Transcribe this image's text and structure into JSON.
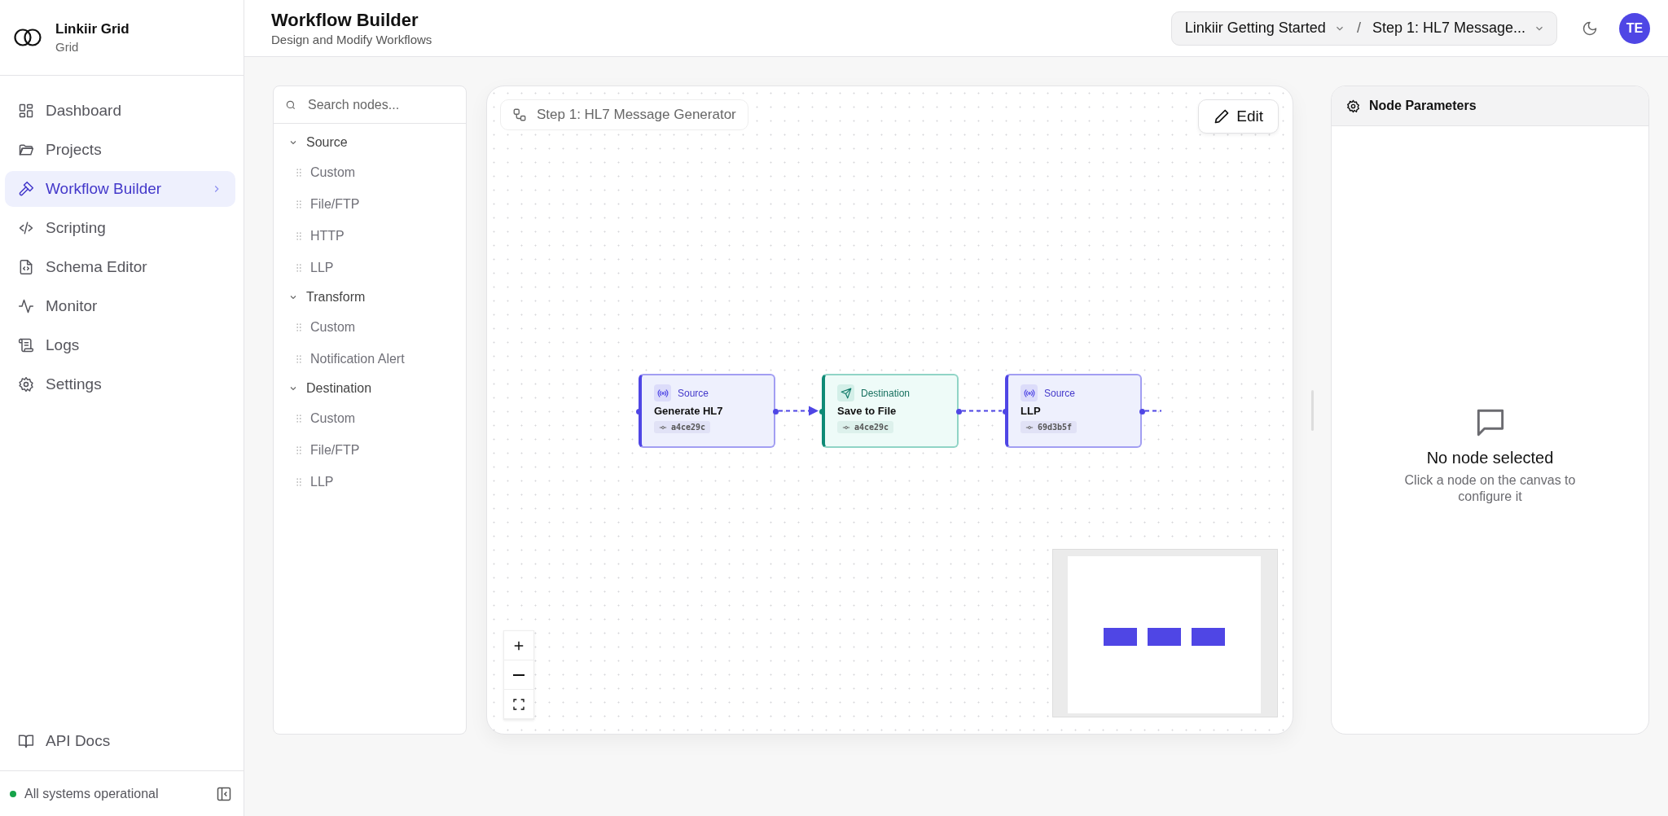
{
  "brand": {
    "name": "Linkiir Grid",
    "subtitle": "Grid"
  },
  "sidebar": {
    "items": [
      {
        "label": "Dashboard",
        "selected": false
      },
      {
        "label": "Projects",
        "selected": false
      },
      {
        "label": "Workflow Builder",
        "selected": true
      },
      {
        "label": "Scripting",
        "selected": false
      },
      {
        "label": "Schema Editor",
        "selected": false
      },
      {
        "label": "Monitor",
        "selected": false
      },
      {
        "label": "Logs",
        "selected": false
      },
      {
        "label": "Settings",
        "selected": false
      }
    ],
    "footer_link": "API Docs",
    "status": "All systems operational"
  },
  "header": {
    "title": "Workflow Builder",
    "subtitle": "Design and Modify Workflows",
    "breadcrumbs": [
      {
        "label": "Linkiir Getting Started"
      },
      {
        "label": "Step 1: HL7 Message..."
      }
    ],
    "separator": "/",
    "avatar": "TE"
  },
  "palette": {
    "search": {
      "placeholder": "Search nodes..."
    },
    "groups": [
      {
        "label": "Source",
        "expanded": true,
        "items": [
          "Custom",
          "File/FTP",
          "HTTP",
          "LLP"
        ]
      },
      {
        "label": "Transform",
        "expanded": true,
        "items": [
          "Custom",
          "Notification Alert"
        ]
      },
      {
        "label": "Destination",
        "expanded": true,
        "items": [
          "Custom",
          "File/FTP",
          "LLP"
        ]
      }
    ]
  },
  "canvas": {
    "workflow_label": "Step 1: HL7 Message Generator",
    "edit_button": "Edit",
    "nodes": [
      {
        "kind": "source",
        "type_label": "Source",
        "title": "Generate HL7",
        "id_label": "a4ce29c"
      },
      {
        "kind": "destination",
        "type_label": "Destination",
        "title": "Save to File",
        "id_label": "a4ce29c"
      },
      {
        "kind": "source",
        "type_label": "Source",
        "title": "LLP",
        "id_label": "69d3b5f"
      }
    ],
    "edges": [
      {
        "kind": "arrow"
      },
      {
        "kind": "line"
      },
      {
        "kind": "open"
      }
    ]
  },
  "parameters": {
    "title": "Node Parameters",
    "empty_title": "No node selected",
    "empty_text": "Click a node on the canvas to configure it"
  }
}
